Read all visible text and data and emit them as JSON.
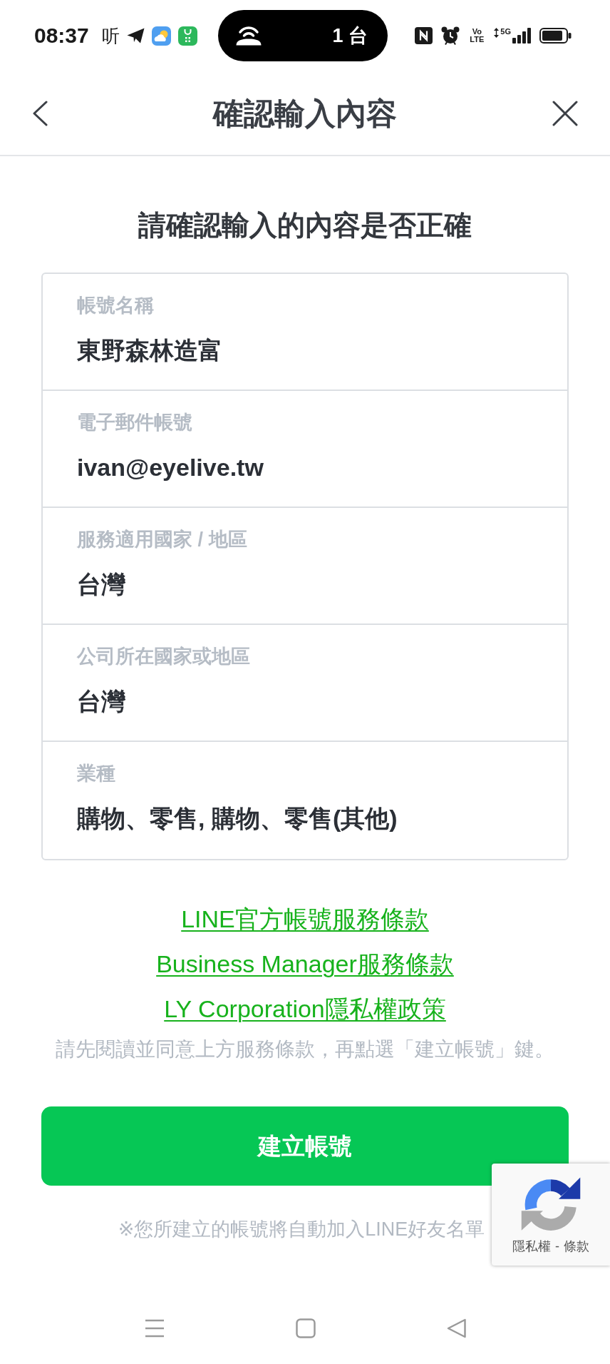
{
  "status_bar": {
    "time": "08:37",
    "app_glyph": "听",
    "island_text": "1 台",
    "volte": "Vo LTE",
    "network": "5G"
  },
  "header": {
    "title": "確認輸入內容"
  },
  "heading": "請確認輸入的內容是否正確",
  "fields": [
    {
      "label": "帳號名稱",
      "value": "東野森林造富"
    },
    {
      "label": "電子郵件帳號",
      "value": "ivan@eyelive.tw"
    },
    {
      "label": "服務適用國家 / 地區",
      "value": "台灣"
    },
    {
      "label": "公司所在國家或地區",
      "value": "台灣"
    },
    {
      "label": "業種",
      "value": "購物、零售, 購物、零售(其他)"
    }
  ],
  "links": [
    "LINE官方帳號服務條款",
    "Business Manager服務條款",
    "LY Corporation隱私權政策"
  ],
  "agreement_note": "請先閱讀並同意上方服務條款，再點選「建立帳號」鍵。",
  "create_button": "建立帳號",
  "footnote": "※您所建立的帳號將自動加入LINE好友名單",
  "recaptcha": {
    "links": [
      "隱私權",
      "條款"
    ],
    "separator": "-"
  }
}
